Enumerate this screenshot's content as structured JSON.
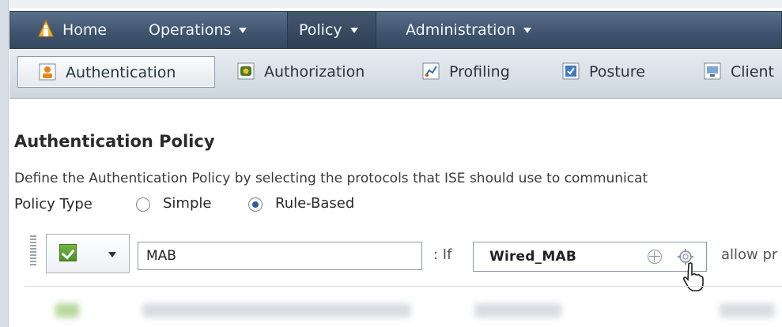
{
  "topnav": {
    "items": [
      {
        "label": "Home",
        "has_caret": false,
        "active": false
      },
      {
        "label": "Operations",
        "has_caret": true,
        "active": false
      },
      {
        "label": "Policy",
        "has_caret": true,
        "active": true
      },
      {
        "label": "Administration",
        "has_caret": true,
        "active": false
      }
    ],
    "home_icon": "home-icon"
  },
  "subnav": {
    "items": [
      {
        "label": "Authentication",
        "icon": "authentication-icon",
        "active": true
      },
      {
        "label": "Authorization",
        "icon": "authorization-icon",
        "active": false
      },
      {
        "label": "Profiling",
        "icon": "profiling-icon",
        "active": false
      },
      {
        "label": "Posture",
        "icon": "posture-icon",
        "active": false
      },
      {
        "label": "Client",
        "icon": "client-provisioning-icon",
        "active": false
      }
    ]
  },
  "page": {
    "title": "Authentication Policy",
    "description": "Define the Authentication Policy by selecting the protocols that ISE should use to communicat",
    "policy_type_label": "Policy Type",
    "policy_type_options": [
      {
        "label": "Simple",
        "checked": false
      },
      {
        "label": "Rule-Based",
        "checked": true
      }
    ]
  },
  "rule": {
    "status_icon": "check-icon",
    "name": "MAB",
    "if_label": ": If",
    "condition": "Wired_MAB",
    "allow_text": "allow pr"
  },
  "colors": {
    "topnav_bg": "#3f5570",
    "subnav_bg": "#dbe2e9",
    "accent": "#2e5d9c",
    "enabled_green": "#4c8f26"
  }
}
